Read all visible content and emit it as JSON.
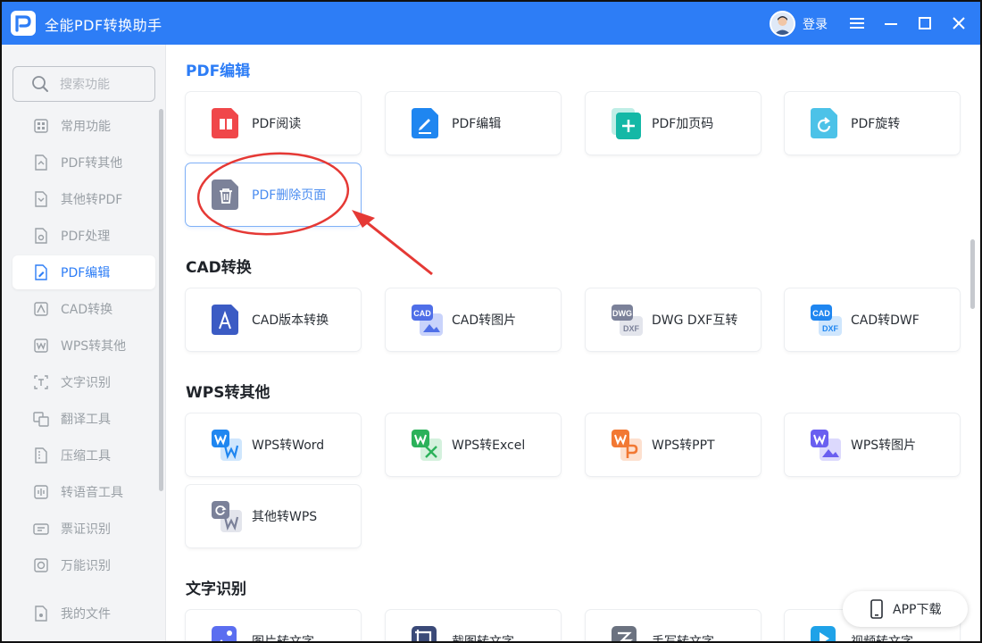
{
  "app": {
    "title": "全能PDF转换助手",
    "login": "登录",
    "logo_letter": "P"
  },
  "sidebar": {
    "search_placeholder": "搜索功能",
    "items": [
      {
        "label": "常用功能",
        "icon": "common-icon"
      },
      {
        "label": "PDF转其他",
        "icon": "pdf-to-other-icon"
      },
      {
        "label": "其他转PDF",
        "icon": "other-to-pdf-icon"
      },
      {
        "label": "PDF处理",
        "icon": "pdf-process-icon"
      },
      {
        "label": "PDF编辑",
        "icon": "pdf-edit-icon",
        "active": true
      },
      {
        "label": "CAD转换",
        "icon": "cad-icon"
      },
      {
        "label": "WPS转其他",
        "icon": "wps-icon"
      },
      {
        "label": "文字识别",
        "icon": "ocr-icon"
      },
      {
        "label": "翻译工具",
        "icon": "translate-icon"
      },
      {
        "label": "压缩工具",
        "icon": "compress-icon"
      },
      {
        "label": "转语音工具",
        "icon": "voice-icon"
      },
      {
        "label": "票证识别",
        "icon": "ticket-icon"
      },
      {
        "label": "万能识别",
        "icon": "universal-icon"
      }
    ],
    "footer_item": {
      "label": "我的文件",
      "icon": "my-files-icon"
    }
  },
  "sections": [
    {
      "title": "PDF编辑",
      "cards": [
        {
          "label": "PDF阅读",
          "icon": "pdf-read-icon",
          "color": "#f0474a"
        },
        {
          "label": "PDF编辑",
          "icon": "pdf-edit-icon",
          "color": "#1f86f0"
        },
        {
          "label": "PDF加页码",
          "icon": "pdf-add-page-number-icon",
          "color": "#14b8a6"
        },
        {
          "label": "PDF旋转",
          "icon": "pdf-rotate-icon",
          "color": "#4cc2e8"
        },
        {
          "label": "PDF删除页面",
          "icon": "pdf-delete-page-icon",
          "color": "#7c8299"
        }
      ]
    },
    {
      "title": "CAD转换",
      "cards": [
        {
          "label": "CAD版本转换",
          "icon": "cad-version-icon",
          "color": "#3b5bc4"
        },
        {
          "label": "CAD转图片",
          "icon": "cad-to-image-icon",
          "color": "#4f6fe8",
          "badge": "CAD"
        },
        {
          "label": "DWG DXF互转",
          "icon": "dwg-dxf-icon",
          "color": "#7b8199",
          "badge": "DWG",
          "badge2": "DXF"
        },
        {
          "label": "CAD转DWF",
          "icon": "cad-to-dwf-icon",
          "color": "#1f86f0",
          "badge": "CAD",
          "badge2": "DXF"
        }
      ]
    },
    {
      "title": "WPS转其他",
      "cards": [
        {
          "label": "WPS转Word",
          "icon": "wps-to-word-icon",
          "color": "#1f86f0"
        },
        {
          "label": "WPS转Excel",
          "icon": "wps-to-excel-icon",
          "color": "#2bb15a"
        },
        {
          "label": "WPS转PPT",
          "icon": "wps-to-ppt-icon",
          "color": "#f27833"
        },
        {
          "label": "WPS转图片",
          "icon": "wps-to-image-icon",
          "color": "#6a5ff0"
        },
        {
          "label": "其他转WPS",
          "icon": "other-to-wps-icon",
          "color": "#7b8199"
        }
      ]
    },
    {
      "title": "文字识别",
      "cards": [
        {
          "label": "图片转文字",
          "icon": "image-to-text-icon",
          "color": "#5b6ef0"
        },
        {
          "label": "截图转文字",
          "icon": "screenshot-to-text-icon",
          "color": "#3b4a78"
        },
        {
          "label": "手写转文字",
          "icon": "handwriting-to-text-icon",
          "color": "#6b7280"
        },
        {
          "label": "视频转文字",
          "icon": "video-to-text-icon",
          "color": "#1fa2e8"
        }
      ]
    }
  ],
  "app_download": "APP下载"
}
